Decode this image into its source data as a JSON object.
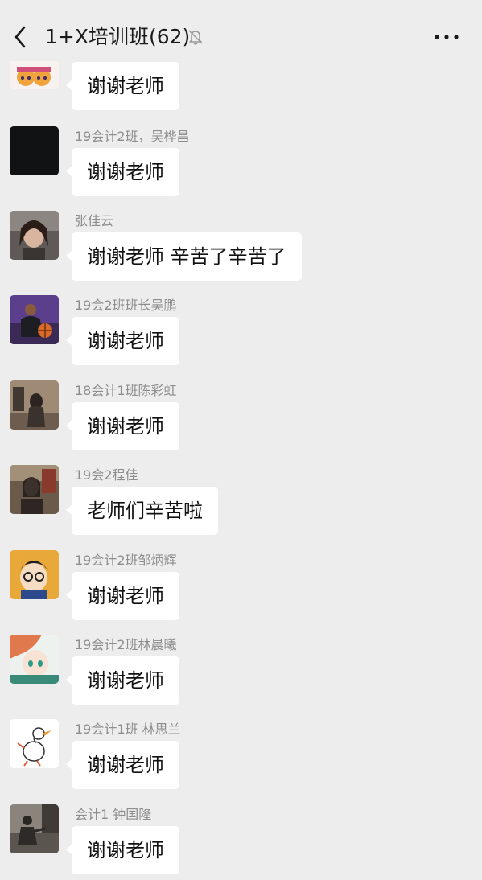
{
  "header": {
    "title": "1+X培训班(62)"
  },
  "messages": [
    {
      "sender": "",
      "text": "谢谢老师",
      "avatar": "emoji-pair-avatar"
    },
    {
      "sender": "19会计2班，吴桦昌",
      "text": "谢谢老师",
      "avatar": "black-square-avatar"
    },
    {
      "sender": "张佳云",
      "text": "谢谢老师 辛苦了辛苦了",
      "avatar": "portrait-photo-avatar"
    },
    {
      "sender": "19会2班班长吴鹏",
      "text": "谢谢老师",
      "avatar": "basketball-player-avatar"
    },
    {
      "sender": "18会计1班陈彩虹",
      "text": "谢谢老师",
      "avatar": "sepia-photo-avatar"
    },
    {
      "sender": "19会2程佳",
      "text": "老师们辛苦啦",
      "avatar": "cafe-photo-avatar"
    },
    {
      "sender": "19会计2班邹炳辉",
      "text": "谢谢老师",
      "avatar": "anime-boy-avatar"
    },
    {
      "sender": "19会计2班林晨曦",
      "text": "谢谢老师",
      "avatar": "anime-girl-avatar"
    },
    {
      "sender": "19会计1班 林思兰",
      "text": "谢谢老师",
      "avatar": "goose-cartoon-avatar"
    },
    {
      "sender": "会计1 钟国隆",
      "text": "谢谢老师",
      "avatar": "street-photo-avatar"
    }
  ],
  "colors": {
    "background": "#ededed",
    "bubble": "#ffffff",
    "sender_text": "#8d8d8d"
  }
}
